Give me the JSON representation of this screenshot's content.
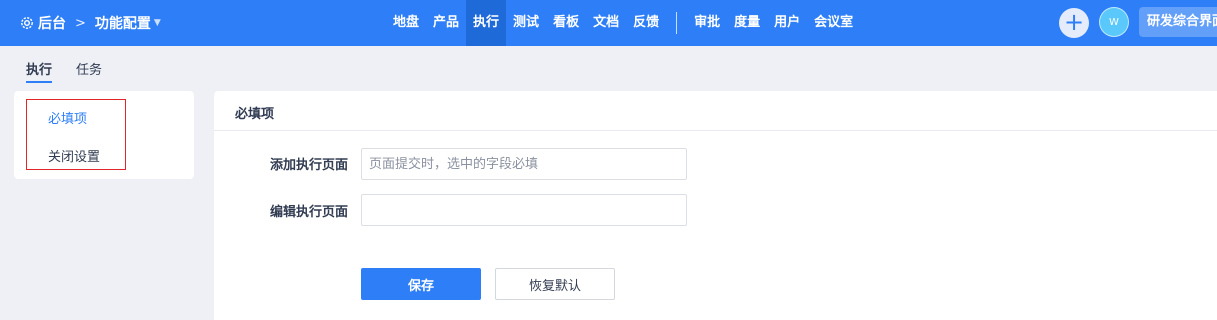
{
  "topbar": {
    "breadcrumb": {
      "root_icon": "gear-icon",
      "root": "后台",
      "separator": ">",
      "current": "功能配置",
      "dropdown_icon": "caret-down-icon"
    },
    "nav_items": [
      "地盘",
      "产品",
      "执行",
      "测试",
      "看板",
      "文档",
      "反馈",
      "审批",
      "度量",
      "用户",
      "会议室"
    ],
    "active_nav": "执行",
    "add_icon": "plus-icon",
    "add_symbol": "+",
    "avatar_text": "W",
    "workspace_label": "研发综合界面",
    "brand_color": "#2e7ff7"
  },
  "tabs": [
    {
      "label": "执行",
      "active": true
    },
    {
      "label": "任务",
      "active": false
    }
  ],
  "sidebar": {
    "items": [
      {
        "label": "必填项",
        "active": true
      },
      {
        "label": "关闭设置",
        "active": false
      }
    ],
    "highlight_color": "#e2252b"
  },
  "panel": {
    "title": "必填项",
    "fields": [
      {
        "label": "添加执行页面",
        "value": "",
        "placeholder": "页面提交时，选中的字段必填"
      },
      {
        "label": "编辑执行页面",
        "value": "",
        "placeholder": ""
      }
    ],
    "save_label": "保存",
    "reset_label": "恢复默认"
  }
}
